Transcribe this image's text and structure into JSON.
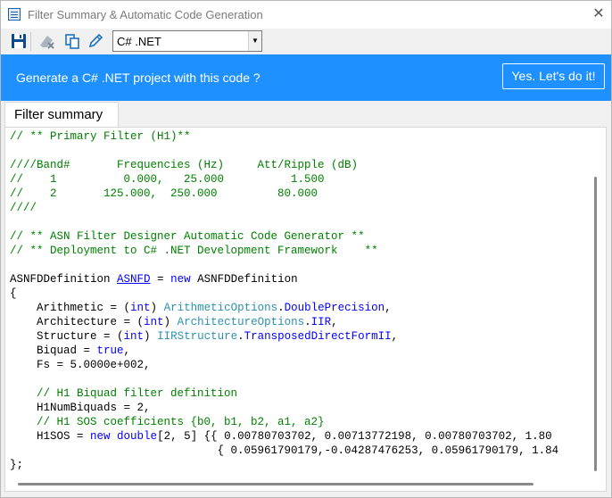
{
  "window": {
    "title": "Filter Summary & Automatic Code Generation",
    "close_glyph": "✕",
    "app_icon": "filter-app-icon"
  },
  "toolbar": {
    "icons": [
      "save-icon",
      "clear-icon",
      "copy-icon",
      "edit-icon"
    ],
    "language": {
      "selected": "C# .NET",
      "dropdown_glyph": "▼"
    }
  },
  "banner": {
    "message": "Generate a C# .NET project with this code ?",
    "button_label": "Yes. Let's do it!",
    "color": "#1e90ff"
  },
  "tabs": [
    {
      "label": "Filter summary",
      "active": true
    }
  ],
  "code": {
    "lines": [
      {
        "segs": [
          {
            "cls": "c",
            "text": "// ** Primary Filter (H1)**"
          }
        ]
      },
      {
        "segs": []
      },
      {
        "segs": [
          {
            "cls": "c",
            "text": "////Band#       Frequencies (Hz)     Att/Ripple (dB)"
          }
        ]
      },
      {
        "segs": [
          {
            "cls": "c",
            "text": "//    1          0.000,   25.000          1.500"
          }
        ]
      },
      {
        "segs": [
          {
            "cls": "c",
            "text": "//    2       125.000,  250.000         80.000"
          }
        ]
      },
      {
        "segs": [
          {
            "cls": "c",
            "text": "////"
          }
        ]
      },
      {
        "segs": []
      },
      {
        "segs": [
          {
            "cls": "c",
            "text": "// ** ASN Filter Designer Automatic Code Generator **"
          }
        ]
      },
      {
        "segs": [
          {
            "cls": "c",
            "text": "// ** Deployment to C# .NET Development Framework    **"
          }
        ]
      },
      {
        "segs": []
      },
      {
        "segs": [
          {
            "cls": "",
            "text": "ASNFDDefinition "
          },
          {
            "cls": "u",
            "text": "ASNFD"
          },
          {
            "cls": "",
            "text": " = "
          },
          {
            "cls": "k",
            "text": "new"
          },
          {
            "cls": "",
            "text": " ASNFDDefinition"
          }
        ]
      },
      {
        "segs": [
          {
            "cls": "",
            "text": "{"
          }
        ]
      },
      {
        "segs": [
          {
            "cls": "",
            "text": "    Arithmetic = ("
          },
          {
            "cls": "k",
            "text": "int"
          },
          {
            "cls": "",
            "text": ") "
          },
          {
            "cls": "t",
            "text": "ArithmeticOptions"
          },
          {
            "cls": "",
            "text": "."
          },
          {
            "cls": "k",
            "text": "DoublePrecision"
          },
          {
            "cls": "",
            "text": ","
          }
        ]
      },
      {
        "segs": [
          {
            "cls": "",
            "text": "    Architecture = ("
          },
          {
            "cls": "k",
            "text": "int"
          },
          {
            "cls": "",
            "text": ") "
          },
          {
            "cls": "t",
            "text": "ArchitectureOptions"
          },
          {
            "cls": "",
            "text": "."
          },
          {
            "cls": "k",
            "text": "IIR"
          },
          {
            "cls": "",
            "text": ","
          }
        ]
      },
      {
        "segs": [
          {
            "cls": "",
            "text": "    Structure = ("
          },
          {
            "cls": "k",
            "text": "int"
          },
          {
            "cls": "",
            "text": ") "
          },
          {
            "cls": "t",
            "text": "IIRStructure"
          },
          {
            "cls": "",
            "text": "."
          },
          {
            "cls": "k",
            "text": "TransposedDirectFormII"
          },
          {
            "cls": "",
            "text": ","
          }
        ]
      },
      {
        "segs": [
          {
            "cls": "",
            "text": "    Biquad = "
          },
          {
            "cls": "k",
            "text": "true"
          },
          {
            "cls": "",
            "text": ","
          }
        ]
      },
      {
        "segs": [
          {
            "cls": "",
            "text": "    Fs = 5.0000e+002,"
          }
        ]
      },
      {
        "segs": []
      },
      {
        "segs": [
          {
            "cls": "c",
            "text": "    // H1 Biquad filter definition"
          }
        ]
      },
      {
        "segs": [
          {
            "cls": "",
            "text": "    H1NumBiquads = 2,"
          }
        ]
      },
      {
        "segs": [
          {
            "cls": "c",
            "text": "    // H1 SOS coefficients {b0, b1, b2, a1, a2}"
          }
        ]
      },
      {
        "segs": [
          {
            "cls": "",
            "text": "    H1SOS = "
          },
          {
            "cls": "k",
            "text": "new"
          },
          {
            "cls": "",
            "text": " "
          },
          {
            "cls": "k",
            "text": "double"
          },
          {
            "cls": "",
            "text": "[2, 5] {{ 0.00780703702, 0.00713772198, 0.00780703702, 1.80"
          }
        ]
      },
      {
        "segs": [
          {
            "cls": "",
            "text": "                               { 0.05961790179,-0.04287476253, 0.05961790179, 1.84"
          }
        ]
      },
      {
        "segs": [
          {
            "cls": "",
            "text": "};"
          }
        ]
      }
    ]
  }
}
